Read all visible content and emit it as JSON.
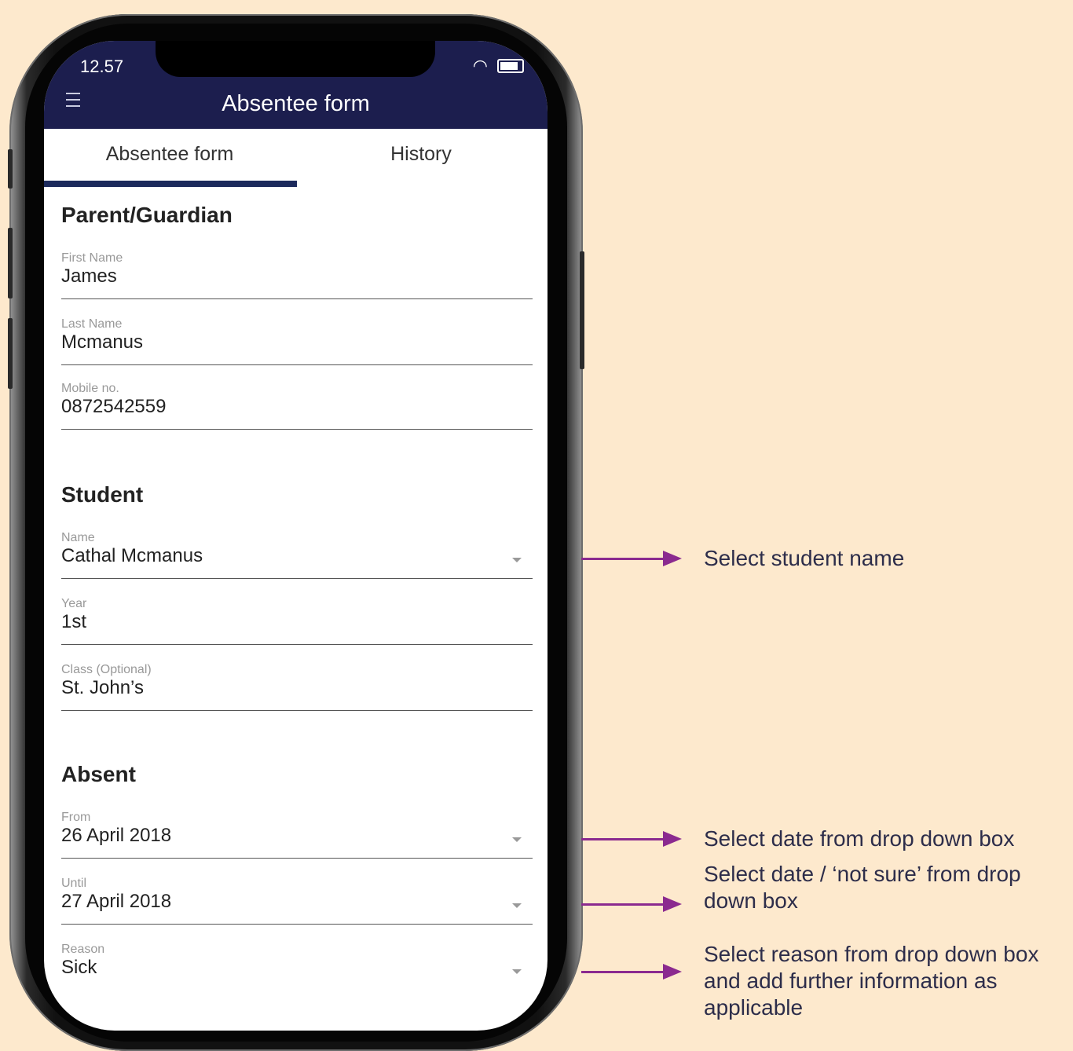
{
  "status_bar": {
    "time": "12.57"
  },
  "header": {
    "title": "Absentee form",
    "menu_icon": "hamburger-menu-icon"
  },
  "tabs": [
    {
      "label": "Absentee form",
      "active": true
    },
    {
      "label": "History",
      "active": false
    }
  ],
  "sections": {
    "parent": {
      "title": "Parent/Guardian",
      "fields": [
        {
          "label": "First Name",
          "value": "James"
        },
        {
          "label": "Last Name",
          "value": "Mcmanus"
        },
        {
          "label": "Mobile no.",
          "value": "0872542559"
        }
      ]
    },
    "student": {
      "title": "Student",
      "fields": [
        {
          "label": "Name",
          "value": "Cathal Mcmanus",
          "dropdown": true
        },
        {
          "label": "Year",
          "value": "1st"
        },
        {
          "label": "Class (Optional)",
          "value": "St. John’s"
        }
      ]
    },
    "absent": {
      "title": "Absent",
      "fields": [
        {
          "label": "From",
          "value": "26 April 2018",
          "dropdown": true
        },
        {
          "label": "Until",
          "value": "27 April 2018",
          "dropdown": true
        },
        {
          "label": "Reason",
          "value": "Sick",
          "dropdown": true
        }
      ]
    }
  },
  "annotations": [
    "Select student name",
    "Select date from drop down box",
    "Select date / ‘not sure’ from drop down box",
    "Select reason from drop down box and add further information as applicable"
  ],
  "colors": {
    "background": "#fde9cd",
    "header": "#1c1e4e",
    "arrow": "#8b2a8f",
    "tab_indicator": "#1c2a5c"
  }
}
